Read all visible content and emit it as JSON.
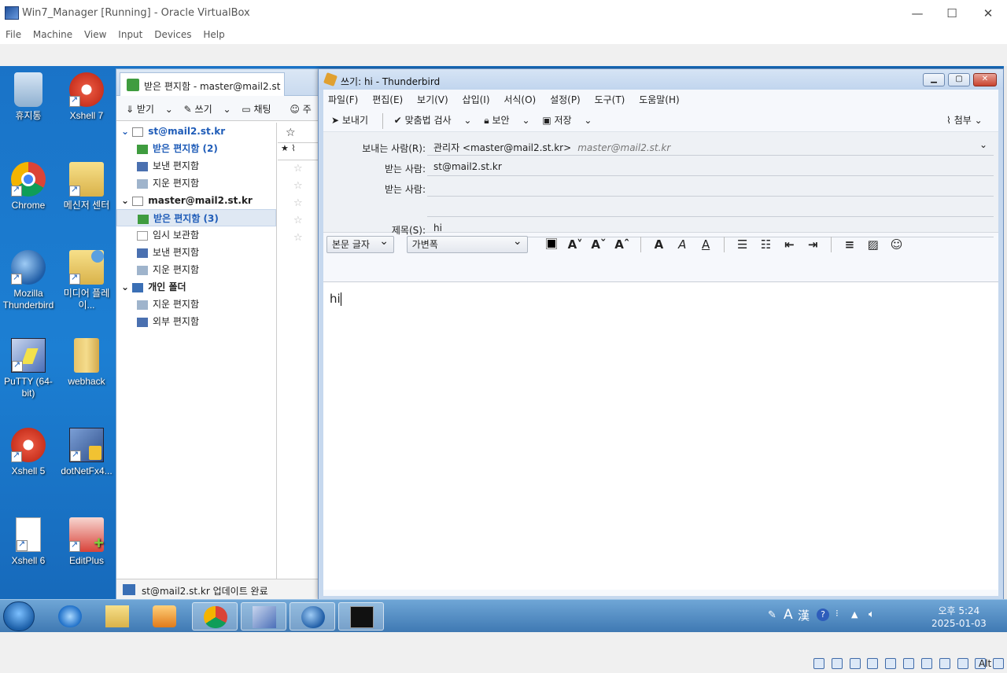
{
  "host": {
    "title": "Win7_Manager [Running] - Oracle VirtualBox",
    "menu": [
      "File",
      "Machine",
      "View",
      "Input",
      "Devices",
      "Help"
    ],
    "controls": {
      "minimize": "—",
      "maximize": "☐",
      "close": "✕"
    },
    "status_host_key": "Alt"
  },
  "desktop": {
    "icons": [
      {
        "label": "휴지통"
      },
      {
        "label": "Xshell 7"
      },
      {
        "label": "Chrome"
      },
      {
        "label": "메신저 센터"
      },
      {
        "label": "Mozilla Thunderbird"
      },
      {
        "label": "미디어 플레이..."
      },
      {
        "label": "PuTTY (64-bit)"
      },
      {
        "label": "webhack"
      },
      {
        "label": "Xshell 5"
      },
      {
        "label": "dotNetFx4..."
      },
      {
        "label": "Xshell 6"
      },
      {
        "label": "EditPlus"
      }
    ]
  },
  "tb_main": {
    "tab_label": "받은 편지함 - master@mail2.st",
    "toolbar": {
      "get": "받기",
      "write": "쓰기",
      "chat": "채팅",
      "address": "주"
    },
    "folders": [
      {
        "label": "st@mail2.st.kr",
        "kind": "account"
      },
      {
        "label": "받은 편지함 (2)",
        "kind": "inbox-unread"
      },
      {
        "label": "보낸 편지함",
        "kind": "folder"
      },
      {
        "label": "지운 편지함",
        "kind": "folder"
      },
      {
        "label": "master@mail2.st.kr",
        "kind": "account"
      },
      {
        "label": "받은 편지함 (3)",
        "kind": "inbox-selected"
      },
      {
        "label": "임시 보관함",
        "kind": "folder"
      },
      {
        "label": "보낸 편지함",
        "kind": "folder"
      },
      {
        "label": "지운 편지함",
        "kind": "folder"
      },
      {
        "label": "개인 폴더",
        "kind": "account"
      },
      {
        "label": "지운 편지함",
        "kind": "folder"
      },
      {
        "label": "외부 편지함",
        "kind": "folder"
      }
    ],
    "status": "st@mail2.st.kr 업데이트 완료"
  },
  "compose": {
    "title": "쓰기: hi - Thunderbird",
    "menu": [
      "파일(F)",
      "편집(E)",
      "보기(V)",
      "삽입(I)",
      "서식(O)",
      "설정(P)",
      "도구(T)",
      "도움말(H)"
    ],
    "toolbar": {
      "send": "보내기",
      "spell": "맞춤법 검사",
      "security": "보안",
      "save": "저장",
      "attach": "첨부"
    },
    "from_label": "보내는 사람(R):",
    "from_value": "관리자 <master@mail2.st.kr>",
    "from_hint": "master@mail2.st.kr",
    "to_label": "받는 사람:",
    "to_value": "st@mail2.st.kr",
    "to2_label": "받는 사람:",
    "to2_value": "",
    "subject_label": "제목(S):",
    "subject_value": "hi",
    "format_paragraph": "본문 글자",
    "format_font": "가변폭",
    "body": "hi"
  },
  "taskbar": {
    "ime_A": "A",
    "ime_han": "漢",
    "time": "오후 5:24",
    "date": "2025-01-03"
  }
}
